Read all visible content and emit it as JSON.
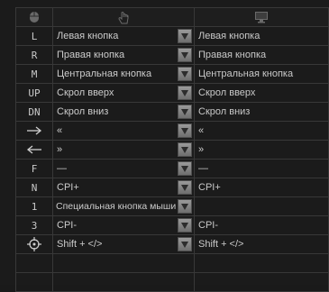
{
  "header": {
    "mouse_icon": "mouse-icon",
    "hand_icon": "hand-icon",
    "monitor_icon": "monitor-icon"
  },
  "rows": [
    {
      "key": "L",
      "assigned": "Левая кнопка",
      "default": "Левая кнопка"
    },
    {
      "key": "R",
      "assigned": "Правая кнопка",
      "default": "Правая кнопка"
    },
    {
      "key": "M",
      "assigned": "Центральная кнопка",
      "default": "Центральная кнопка"
    },
    {
      "key": "UP",
      "assigned": "Скрол вверх",
      "default": "Скрол вверх"
    },
    {
      "key": "DN",
      "assigned": "Скрол вниз",
      "default": "Скрол вниз"
    },
    {
      "key_icon": "arrow-right-icon",
      "assigned": "«",
      "default": "«"
    },
    {
      "key_icon": "arrow-left-icon",
      "assigned": "»",
      "default": "»"
    },
    {
      "key": "F",
      "assigned": "—",
      "default": "—"
    },
    {
      "key": "N",
      "assigned": "CPI+",
      "default": "CPI+"
    },
    {
      "key": "1",
      "assigned": "Специальная кнопка мыши",
      "default": ""
    },
    {
      "key": "3",
      "assigned": "CPI-",
      "default": "CPI-"
    },
    {
      "key_icon": "crosshair-icon",
      "assigned": "Shift + </>",
      "default": "Shift + </>"
    }
  ]
}
